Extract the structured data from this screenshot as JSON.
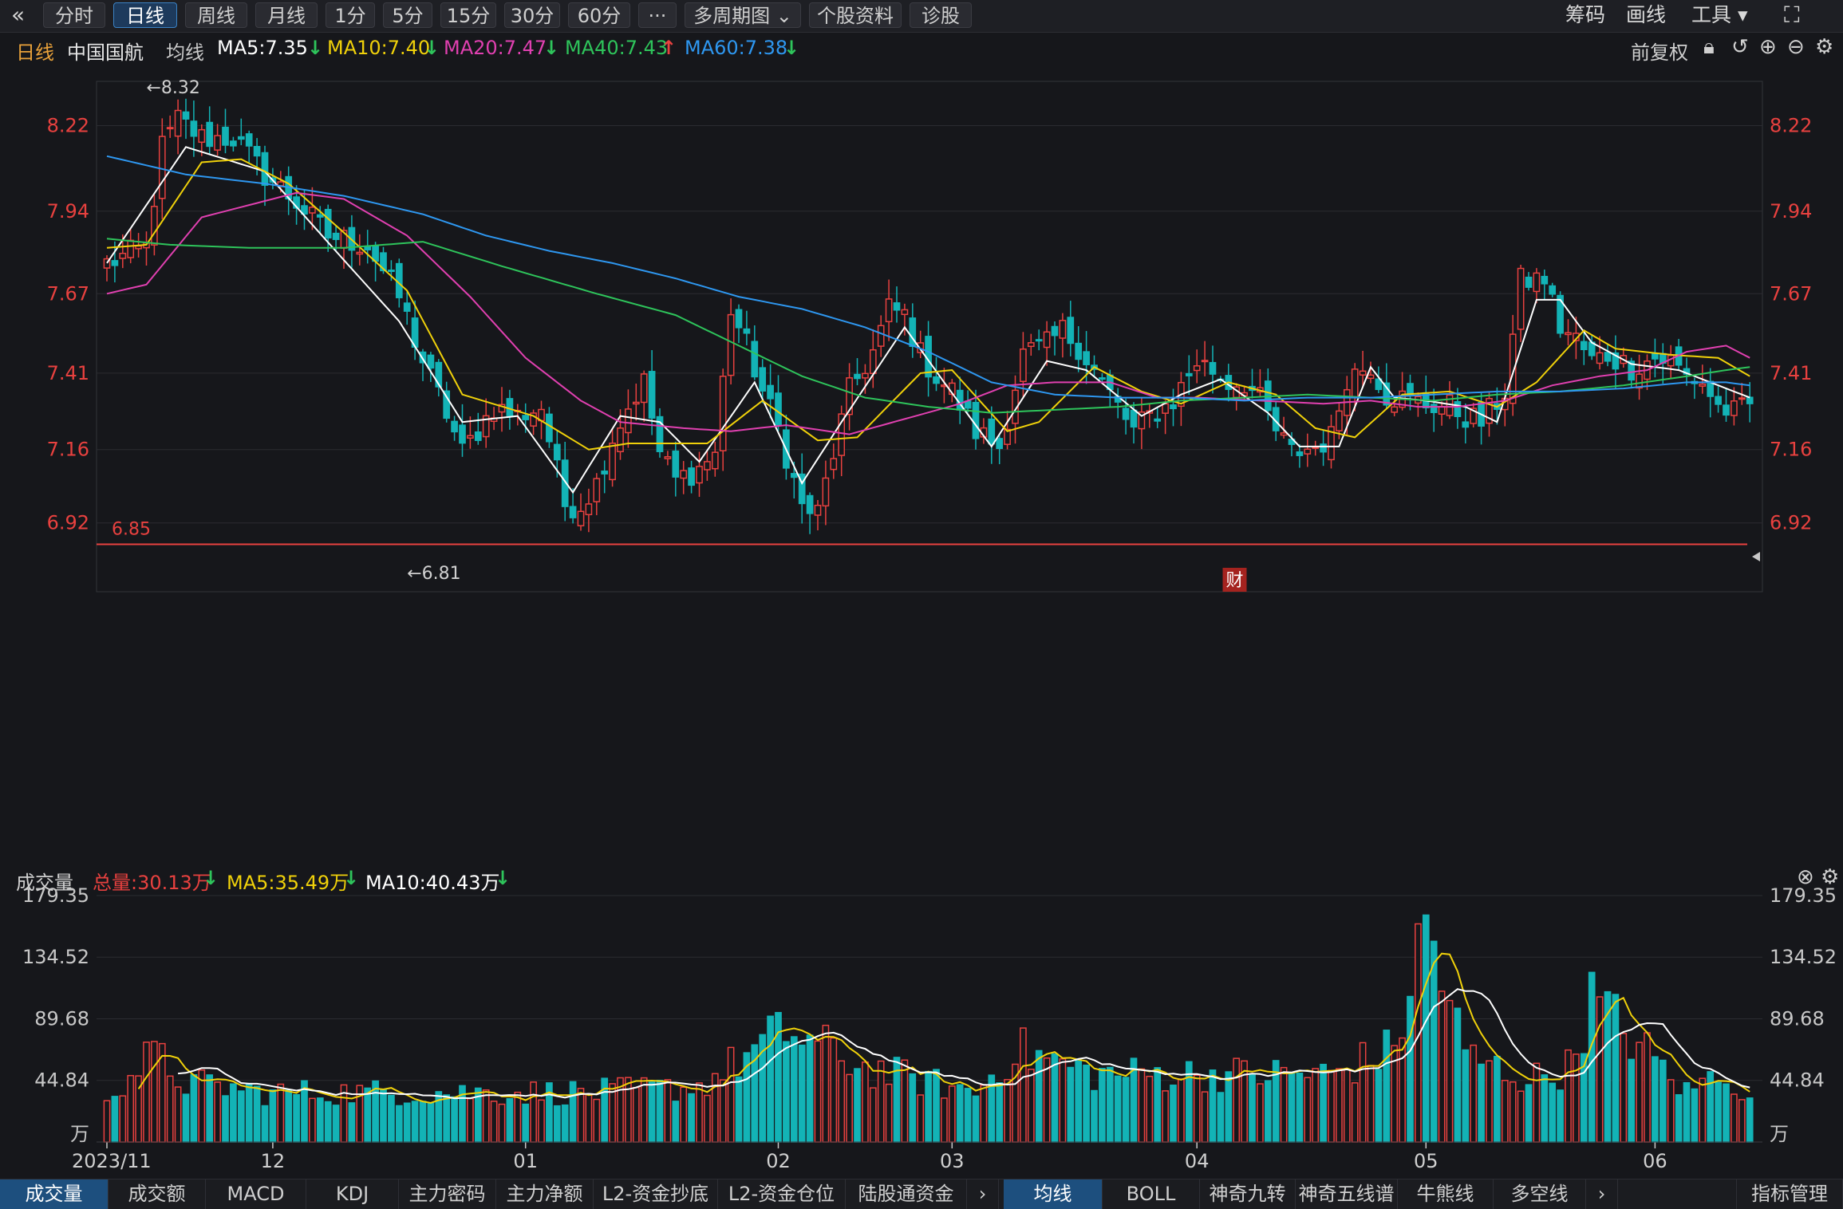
{
  "toolbar": {
    "back_icon": "«",
    "periods": [
      "分时",
      "日线",
      "周线",
      "月线",
      "1分",
      "5分",
      "15分",
      "30分",
      "60分",
      "···",
      "多周期图 ⌄",
      "个股资料",
      "诊股"
    ],
    "active_period": "日线",
    "right_items": [
      "筹码",
      "画线",
      "工具 ▾"
    ],
    "fullscreen_icon": "⛶"
  },
  "legend": {
    "period": "日线",
    "name": "中国国航",
    "ma_label": "均线",
    "ma5": "MA5:7.35",
    "ma10": "MA10:7.40",
    "ma20": "MA20:7.47",
    "ma40": "MA40:7.43",
    "ma60": "MA60:7.38",
    "adjust": "前复权"
  },
  "volume_legend": {
    "title": "成交量",
    "total": "总量:30.13万",
    "ma5": "MA5:35.49万",
    "ma10": "MA10:40.43万"
  },
  "bottom_tabs_left": [
    "成交量",
    "成交额",
    "MACD",
    "KDJ",
    "主力密码",
    "主力净额",
    "L2-资金抄底",
    "L2-资金仓位",
    "陆股通资金"
  ],
  "bottom_tabs_right": [
    "均线",
    "BOLL",
    "神奇九转",
    "神奇五线谱",
    "牛熊线",
    "多空线"
  ],
  "bottom_right": "指标管理",
  "colors": {
    "up": "#e8413f",
    "down": "#13b3b6",
    "ma5": "#ffffff",
    "ma10": "#f0d10a",
    "ma20": "#e040b0",
    "ma40": "#2ec45b",
    "ma60": "#2e97f0"
  },
  "chart_data": [
    {
      "type": "candlestick",
      "title": "中国国航 日线",
      "price_ticks": [
        8.22,
        7.94,
        7.67,
        7.41,
        7.16,
        6.92
      ],
      "ylim": [
        6.7,
        8.37
      ],
      "high_label": "←8.32",
      "low_label": "←6.81",
      "horizontal_line": {
        "value": 6.85,
        "label": "6.85"
      },
      "x_labels": [
        {
          "index": 0,
          "label": "2023/11"
        },
        {
          "index": 21,
          "label": "12"
        },
        {
          "index": 53,
          "label": "01"
        },
        {
          "index": 85,
          "label": "02"
        },
        {
          "index": 107,
          "label": "03"
        },
        {
          "index": 138,
          "label": "04"
        },
        {
          "index": 167,
          "label": "05"
        },
        {
          "index": 196,
          "label": "06"
        }
      ],
      "event_marker": {
        "index": 135,
        "label": "财"
      },
      "anchors": [
        [
          0,
          7.77
        ],
        [
          5,
          7.82
        ],
        [
          7,
          8.15
        ],
        [
          9,
          8.24
        ],
        [
          12,
          8.18
        ],
        [
          16,
          8.18
        ],
        [
          20,
          8.06
        ],
        [
          24,
          7.97
        ],
        [
          28,
          7.86
        ],
        [
          33,
          7.83
        ],
        [
          37,
          7.66
        ],
        [
          40,
          7.45
        ],
        [
          43,
          7.28
        ],
        [
          45,
          7.15
        ],
        [
          49,
          7.3
        ],
        [
          52,
          7.27
        ],
        [
          55,
          7.3
        ],
        [
          58,
          6.98
        ],
        [
          60,
          6.98
        ],
        [
          62,
          7.05
        ],
        [
          64,
          7.2
        ],
        [
          66,
          7.3
        ],
        [
          68,
          7.38
        ],
        [
          70,
          7.15
        ],
        [
          72,
          7.06
        ],
        [
          75,
          7.1
        ],
        [
          77,
          7.15
        ],
        [
          79,
          7.62
        ],
        [
          81,
          7.5
        ],
        [
          83,
          7.35
        ],
        [
          85,
          7.23
        ],
        [
          88,
          6.97
        ],
        [
          90,
          6.95
        ],
        [
          92,
          7.15
        ],
        [
          94,
          7.35
        ],
        [
          97,
          7.48
        ],
        [
          99,
          7.62
        ],
        [
          101,
          7.6
        ],
        [
          103,
          7.47
        ],
        [
          105,
          7.4
        ],
        [
          107,
          7.35
        ],
        [
          110,
          7.22
        ],
        [
          113,
          7.17
        ],
        [
          116,
          7.47
        ],
        [
          119,
          7.5
        ],
        [
          121,
          7.55
        ],
        [
          123,
          7.5
        ],
        [
          125,
          7.42
        ],
        [
          128,
          7.3
        ],
        [
          130,
          7.22
        ],
        [
          132,
          7.27
        ],
        [
          135,
          7.32
        ],
        [
          138,
          7.45
        ],
        [
          140,
          7.42
        ],
        [
          142,
          7.38
        ],
        [
          144,
          7.38
        ],
        [
          146,
          7.32
        ],
        [
          148,
          7.22
        ],
        [
          150,
          7.15
        ],
        [
          153,
          7.17
        ],
        [
          155,
          7.2
        ],
        [
          157,
          7.4
        ],
        [
          160,
          7.44
        ],
        [
          162,
          7.34
        ],
        [
          165,
          7.32
        ],
        [
          167,
          7.31
        ],
        [
          170,
          7.3
        ],
        [
          172,
          7.27
        ],
        [
          174,
          7.25
        ],
        [
          177,
          7.35
        ],
        [
          179,
          7.71
        ],
        [
          182,
          7.72
        ],
        [
          184,
          7.56
        ],
        [
          186,
          7.52
        ],
        [
          188,
          7.45
        ],
        [
          190,
          7.47
        ],
        [
          193,
          7.43
        ],
        [
          196,
          7.46
        ],
        [
          198,
          7.45
        ],
        [
          200,
          7.4
        ],
        [
          202,
          7.38
        ],
        [
          204,
          7.3
        ],
        [
          206,
          7.28
        ],
        [
          208,
          7.3
        ]
      ],
      "ma_lines": {
        "MA5": [
          [
            0,
            7.77
          ],
          [
            10,
            8.15
          ],
          [
            20,
            8.07
          ],
          [
            30,
            7.78
          ],
          [
            37,
            7.58
          ],
          [
            45,
            7.25
          ],
          [
            52,
            7.27
          ],
          [
            59,
            7.02
          ],
          [
            65,
            7.27
          ],
          [
            70,
            7.25
          ],
          [
            75,
            7.12
          ],
          [
            82,
            7.38
          ],
          [
            88,
            7.05
          ],
          [
            93,
            7.25
          ],
          [
            101,
            7.56
          ],
          [
            106,
            7.38
          ],
          [
            112,
            7.17
          ],
          [
            119,
            7.45
          ],
          [
            124,
            7.42
          ],
          [
            131,
            7.27
          ],
          [
            136,
            7.34
          ],
          [
            141,
            7.39
          ],
          [
            147,
            7.28
          ],
          [
            151,
            7.17
          ],
          [
            156,
            7.17
          ],
          [
            160,
            7.43
          ],
          [
            163,
            7.33
          ],
          [
            167,
            7.32
          ],
          [
            172,
            7.3
          ],
          [
            176,
            7.25
          ],
          [
            181,
            7.65
          ],
          [
            184,
            7.65
          ],
          [
            188,
            7.51
          ],
          [
            193,
            7.44
          ],
          [
            199,
            7.42
          ],
          [
            204,
            7.37
          ],
          [
            208,
            7.33
          ]
        ],
        "MA10": [
          [
            0,
            7.82
          ],
          [
            5,
            7.83
          ],
          [
            12,
            8.1
          ],
          [
            17,
            8.11
          ],
          [
            23,
            8.03
          ],
          [
            30,
            7.87
          ],
          [
            38,
            7.68
          ],
          [
            45,
            7.34
          ],
          [
            54,
            7.27
          ],
          [
            61,
            7.16
          ],
          [
            66,
            7.18
          ],
          [
            76,
            7.18
          ],
          [
            83,
            7.32
          ],
          [
            90,
            7.19
          ],
          [
            95,
            7.2
          ],
          [
            103,
            7.41
          ],
          [
            107,
            7.42
          ],
          [
            114,
            7.22
          ],
          [
            118,
            7.25
          ],
          [
            125,
            7.43
          ],
          [
            131,
            7.35
          ],
          [
            136,
            7.31
          ],
          [
            142,
            7.38
          ],
          [
            148,
            7.34
          ],
          [
            153,
            7.23
          ],
          [
            158,
            7.2
          ],
          [
            164,
            7.34
          ],
          [
            170,
            7.35
          ],
          [
            176,
            7.3
          ],
          [
            181,
            7.38
          ],
          [
            187,
            7.55
          ],
          [
            191,
            7.49
          ],
          [
            198,
            7.47
          ],
          [
            204,
            7.46
          ],
          [
            208,
            7.4
          ]
        ],
        "MA20": [
          [
            0,
            7.67
          ],
          [
            5,
            7.7
          ],
          [
            12,
            7.92
          ],
          [
            18,
            7.96
          ],
          [
            24,
            8.0
          ],
          [
            30,
            7.98
          ],
          [
            38,
            7.86
          ],
          [
            46,
            7.66
          ],
          [
            53,
            7.46
          ],
          [
            60,
            7.32
          ],
          [
            65,
            7.25
          ],
          [
            73,
            7.23
          ],
          [
            79,
            7.22
          ],
          [
            86,
            7.24
          ],
          [
            94,
            7.21
          ],
          [
            101,
            7.26
          ],
          [
            108,
            7.31
          ],
          [
            114,
            7.37
          ],
          [
            120,
            7.38
          ],
          [
            127,
            7.38
          ],
          [
            133,
            7.33
          ],
          [
            138,
            7.33
          ],
          [
            146,
            7.32
          ],
          [
            154,
            7.31
          ],
          [
            160,
            7.32
          ],
          [
            166,
            7.3
          ],
          [
            171,
            7.3
          ],
          [
            177,
            7.32
          ],
          [
            183,
            7.37
          ],
          [
            189,
            7.4
          ],
          [
            195,
            7.42
          ],
          [
            200,
            7.48
          ],
          [
            205,
            7.5
          ],
          [
            208,
            7.46
          ]
        ],
        "MA40": [
          [
            0,
            7.85
          ],
          [
            8,
            7.83
          ],
          [
            18,
            7.82
          ],
          [
            30,
            7.82
          ],
          [
            40,
            7.84
          ],
          [
            50,
            7.76
          ],
          [
            62,
            7.67
          ],
          [
            72,
            7.6
          ],
          [
            80,
            7.5
          ],
          [
            88,
            7.4
          ],
          [
            96,
            7.33
          ],
          [
            104,
            7.3
          ],
          [
            112,
            7.28
          ],
          [
            120,
            7.29
          ],
          [
            128,
            7.3
          ],
          [
            136,
            7.32
          ],
          [
            144,
            7.33
          ],
          [
            152,
            7.34
          ],
          [
            160,
            7.33
          ],
          [
            168,
            7.32
          ],
          [
            176,
            7.34
          ],
          [
            184,
            7.35
          ],
          [
            192,
            7.37
          ],
          [
            200,
            7.4
          ],
          [
            205,
            7.42
          ],
          [
            208,
            7.43
          ]
        ],
        "MA60": [
          [
            0,
            8.12
          ],
          [
            10,
            8.06
          ],
          [
            20,
            8.03
          ],
          [
            30,
            7.99
          ],
          [
            40,
            7.93
          ],
          [
            48,
            7.86
          ],
          [
            56,
            7.81
          ],
          [
            64,
            7.77
          ],
          [
            72,
            7.72
          ],
          [
            80,
            7.66
          ],
          [
            88,
            7.62
          ],
          [
            96,
            7.56
          ],
          [
            104,
            7.48
          ],
          [
            112,
            7.38
          ],
          [
            120,
            7.34
          ],
          [
            128,
            7.33
          ],
          [
            136,
            7.33
          ],
          [
            144,
            7.32
          ],
          [
            152,
            7.33
          ],
          [
            160,
            7.33
          ],
          [
            168,
            7.34
          ],
          [
            176,
            7.35
          ],
          [
            184,
            7.35
          ],
          [
            192,
            7.36
          ],
          [
            200,
            7.38
          ],
          [
            205,
            7.38
          ],
          [
            208,
            7.37
          ]
        ]
      }
    },
    {
      "type": "bar",
      "title": "成交量",
      "unit": "万",
      "y_ticks": [
        179.35,
        134.52,
        89.68,
        44.84
      ],
      "ylim": [
        0,
        179.35
      ],
      "volume_peaks": [
        [
          0,
          40
        ],
        [
          6,
          70
        ],
        [
          10,
          48
        ],
        [
          20,
          40
        ],
        [
          40,
          40
        ],
        [
          50,
          40
        ],
        [
          62,
          40
        ],
        [
          75,
          45
        ],
        [
          86,
          90
        ],
        [
          96,
          60
        ],
        [
          110,
          40
        ],
        [
          115,
          75
        ],
        [
          125,
          55
        ],
        [
          140,
          55
        ],
        [
          145,
          55
        ],
        [
          155,
          55
        ],
        [
          163,
          75
        ],
        [
          167,
          178
        ],
        [
          172,
          70
        ],
        [
          180,
          50
        ],
        [
          185,
          60
        ],
        [
          188,
          115
        ],
        [
          193,
          85
        ],
        [
          200,
          40
        ],
        [
          205,
          60
        ],
        [
          208,
          30
        ]
      ]
    }
  ]
}
